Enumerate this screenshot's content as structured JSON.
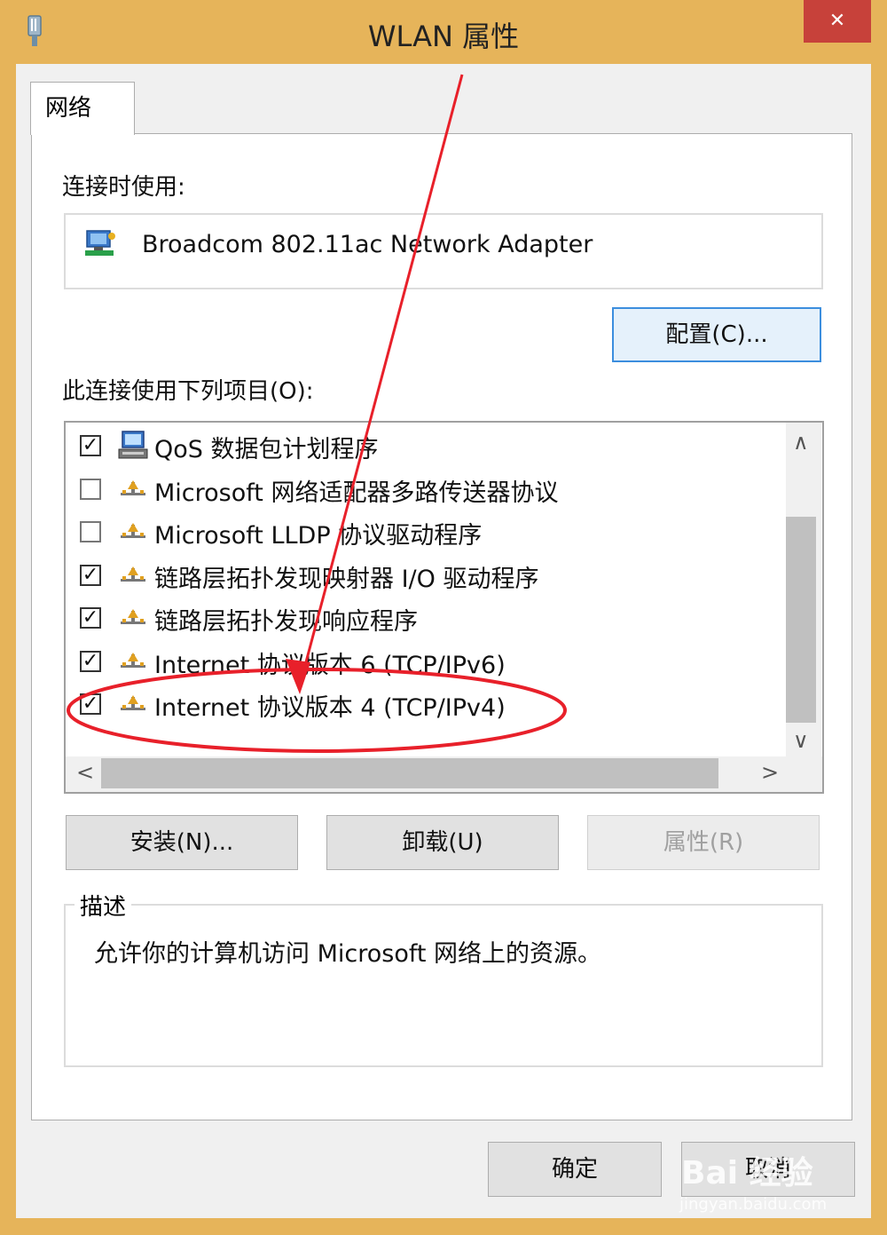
{
  "window": {
    "title": "WLAN 属性",
    "close_glyph": "✕"
  },
  "tabs": [
    {
      "label": "网络",
      "selected": true
    }
  ],
  "connect_using": {
    "label": "连接时使用:",
    "adapter_name": "Broadcom 802.11ac Network Adapter",
    "configure_button": "配置(C)..."
  },
  "items_section": {
    "label": "此连接使用下列项目(O):",
    "items": [
      {
        "label": "QoS 数据包计划程序",
        "checked": true,
        "icon": "qos-scheduler-icon"
      },
      {
        "label": "Microsoft 网络适配器多路传送器协议",
        "checked": false,
        "icon": "protocol-icon"
      },
      {
        "label": "Microsoft LLDP 协议驱动程序",
        "checked": false,
        "icon": "protocol-icon"
      },
      {
        "label": "链路层拓扑发现映射器 I/O 驱动程序",
        "checked": true,
        "icon": "protocol-icon"
      },
      {
        "label": "链路层拓扑发现响应程序",
        "checked": true,
        "icon": "protocol-icon"
      },
      {
        "label": "Internet 协议版本 6 (TCP/IPv6)",
        "checked": true,
        "icon": "protocol-icon"
      },
      {
        "label": "Internet 协议版本 4 (TCP/IPv4)",
        "checked": true,
        "icon": "protocol-icon"
      }
    ]
  },
  "action_buttons": {
    "install": "安装(N)...",
    "uninstall": "卸载(U)",
    "properties": "属性(R)"
  },
  "description": {
    "title": "描述",
    "text": "允许你的计算机访问 Microsoft 网络上的资源。"
  },
  "footer_buttons": {
    "ok": "确定",
    "cancel": "取消"
  },
  "watermark": {
    "brand": "Bai 经验",
    "url": "jingyan.baidu.com"
  },
  "colors": {
    "frame": "#e6b45a",
    "close": "#c7413a",
    "annotation": "#e8202a"
  }
}
